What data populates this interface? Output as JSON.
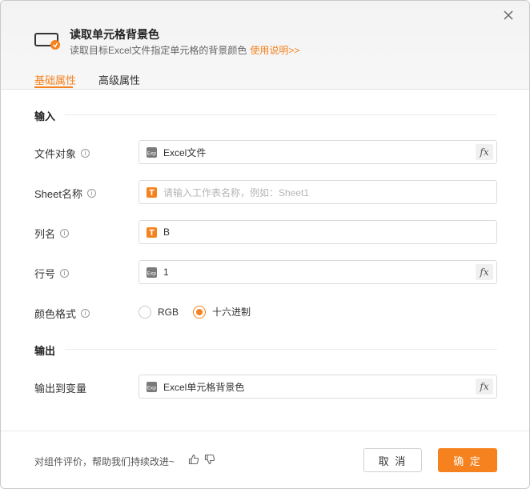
{
  "header": {
    "title": "读取单元格背景色",
    "description": "读取目标Excel文件指定单元格的背景颜色",
    "help_link": "使用说明>>"
  },
  "tabs": [
    {
      "label": "基础属性",
      "active": true
    },
    {
      "label": "高级属性",
      "active": false
    }
  ],
  "sections": {
    "input": "输入",
    "output": "输出"
  },
  "fields": {
    "file_object": {
      "label": "文件对象",
      "value": "Excel文件",
      "icon": "expression-icon"
    },
    "sheet_name": {
      "label": "Sheet名称",
      "placeholder": "请输入工作表名称，例如：Sheet1",
      "icon": "text-icon"
    },
    "column_name": {
      "label": "列名",
      "value": "B",
      "icon": "text-icon"
    },
    "row_number": {
      "label": "行号",
      "value": "1",
      "icon": "expression-icon"
    },
    "color_format": {
      "label": "颜色格式",
      "options": [
        "RGB",
        "十六进制"
      ],
      "selected": "十六进制"
    },
    "output_var": {
      "label": "输出到变量",
      "value": "Excel单元格背景色",
      "icon": "expression-icon"
    }
  },
  "fx_label": "fx",
  "info_glyph": "i",
  "footer": {
    "feedback": "对组件评价，帮助我们持续改进~",
    "cancel": "取 消",
    "ok": "确 定"
  },
  "colors": {
    "accent": "#f5821f"
  }
}
